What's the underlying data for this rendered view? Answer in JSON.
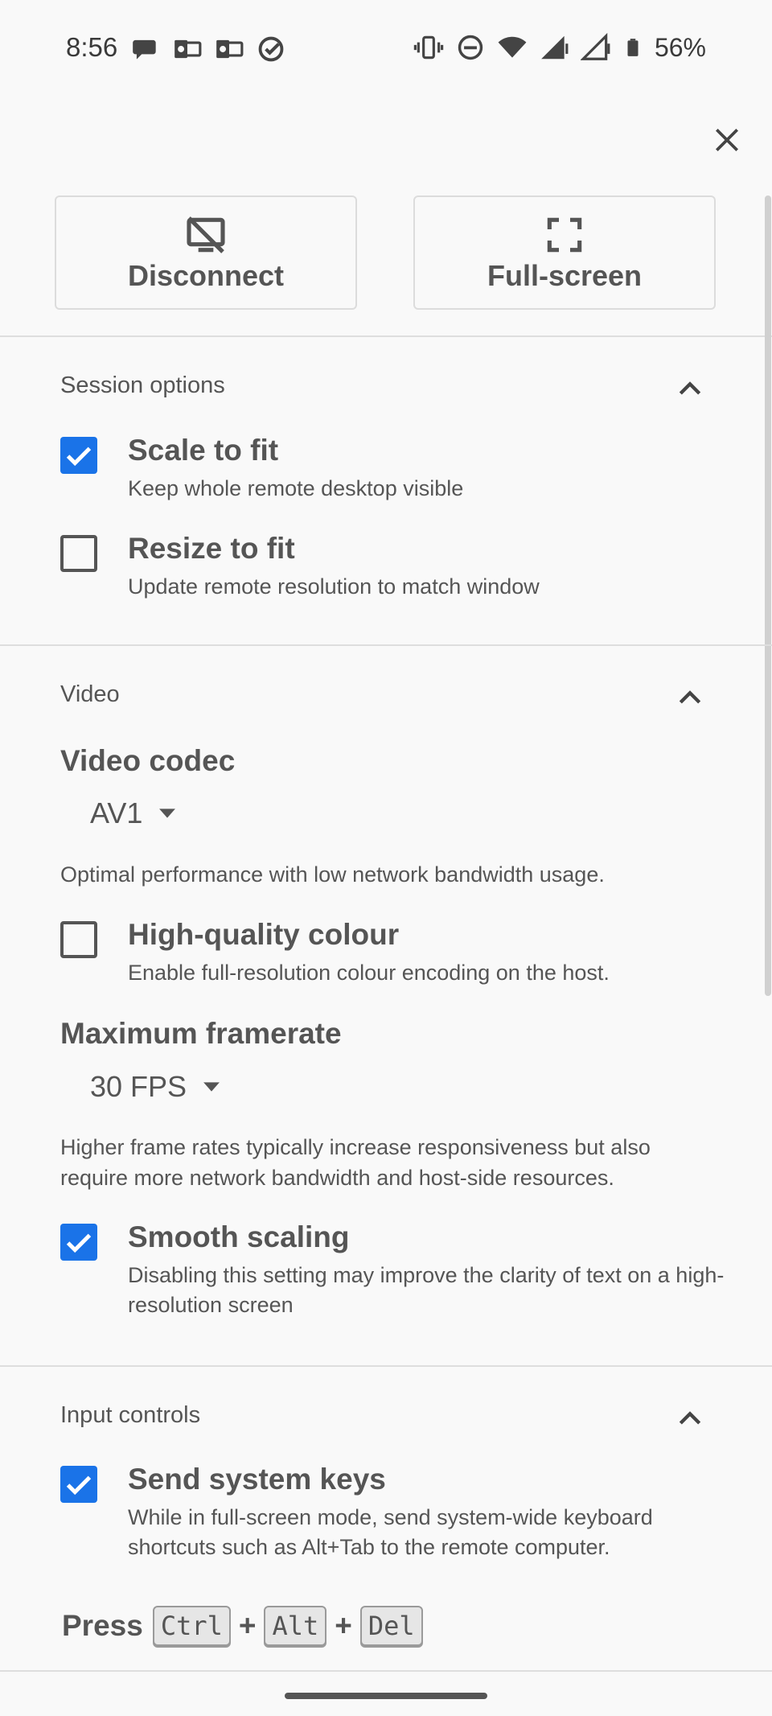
{
  "status_bar": {
    "time": "8:56",
    "battery": "56%"
  },
  "actions": {
    "disconnect_label": "Disconnect",
    "fullscreen_label": "Full-screen"
  },
  "session": {
    "title": "Session options",
    "scale_to_fit": {
      "title": "Scale to fit",
      "desc": "Keep whole remote desktop visible",
      "checked": true
    },
    "resize_to_fit": {
      "title": "Resize to fit",
      "desc": "Update remote resolution to match window",
      "checked": false
    }
  },
  "video": {
    "title": "Video",
    "codec_label": "Video codec",
    "codec_value": "AV1",
    "codec_helper": "Optimal performance with low network bandwidth usage.",
    "hq_colour": {
      "title": "High-quality colour",
      "desc": "Enable full-resolution colour encoding on the host.",
      "checked": false
    },
    "framerate_label": "Maximum framerate",
    "framerate_value": "30 FPS",
    "framerate_helper": "Higher frame rates typically increase responsiveness but also require more network bandwidth and host-side resources.",
    "smooth_scaling": {
      "title": "Smooth scaling",
      "desc": "Disabling this setting may improve the clarity of text on a high-resolution screen",
      "checked": true
    }
  },
  "input": {
    "title": "Input controls",
    "system_keys": {
      "title": "Send system keys",
      "desc": "While in full-screen mode, send system-wide keyboard shortcuts such as Alt+Tab to the remote computer.",
      "checked": true
    },
    "press_label": "Press",
    "keys": [
      "Ctrl",
      "Alt",
      "Del"
    ],
    "plus": "+"
  },
  "colors": {
    "accent": "#1a73e8",
    "background": "#f9f9f9",
    "divider": "#dedede"
  }
}
